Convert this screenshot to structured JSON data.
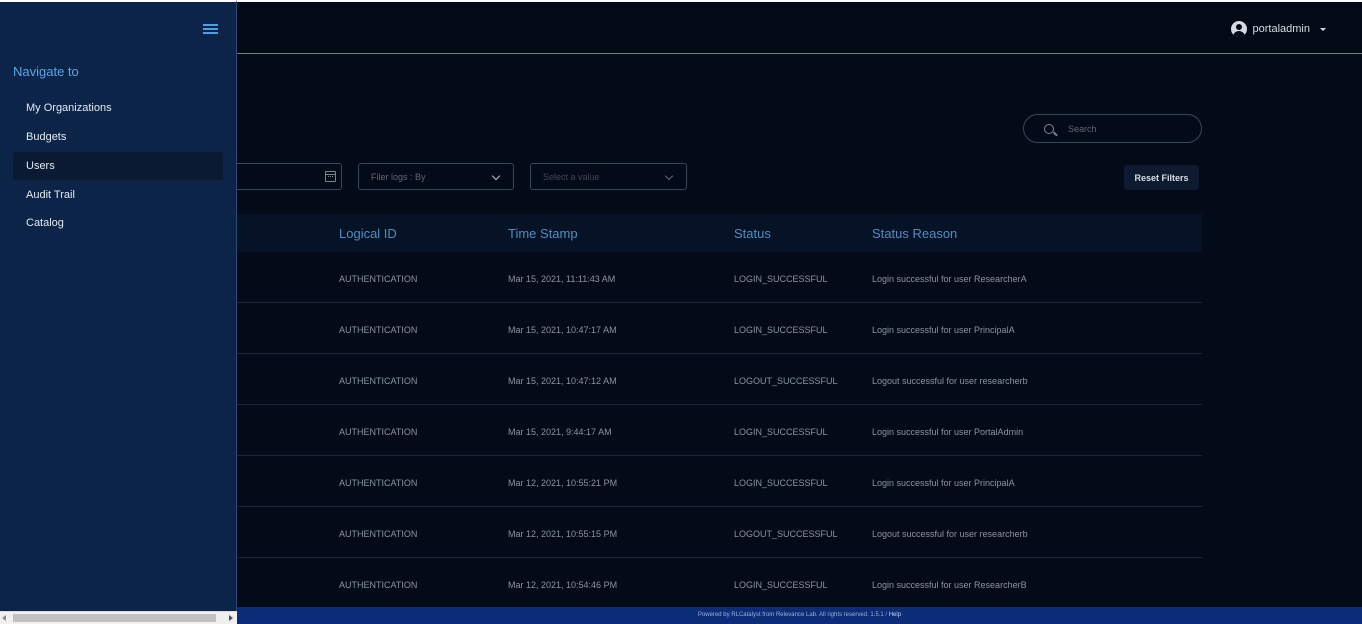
{
  "header": {
    "username": "portaladmin"
  },
  "sidebar": {
    "title": "Navigate to",
    "items": [
      {
        "label": "My Organizations",
        "active": false
      },
      {
        "label": "Budgets",
        "active": false
      },
      {
        "label": "Users",
        "active": true
      },
      {
        "label": "Audit Trail",
        "active": false
      },
      {
        "label": "Catalog",
        "active": false
      }
    ]
  },
  "search": {
    "placeholder": "Search"
  },
  "filters": {
    "date_placeholder": "e",
    "filter_by_placeholder": "Filer logs : By",
    "value_placeholder": "Select a value",
    "reset_label": "Reset Filters"
  },
  "table": {
    "columns": [
      "Logical ID",
      "Time Stamp",
      "Status",
      "Status Reason"
    ],
    "rows": [
      [
        "AUTHENTICATION",
        "Mar 15, 2021, 11:11:43 AM",
        "LOGIN_SUCCESSFUL",
        "Login successful for user ResearcherA"
      ],
      [
        "AUTHENTICATION",
        "Mar 15, 2021, 10:47:17 AM",
        "LOGIN_SUCCESSFUL",
        "Login successful for user PrincipalA"
      ],
      [
        "AUTHENTICATION",
        "Mar 15, 2021, 10:47:12 AM",
        "LOGOUT_SUCCESSFUL",
        "Logout successful for user researcherb"
      ],
      [
        "AUTHENTICATION",
        "Mar 15, 2021, 9:44:17 AM",
        "LOGIN_SUCCESSFUL",
        "Login successful for user PortalAdmin"
      ],
      [
        "AUTHENTICATION",
        "Mar 12, 2021, 10:55:21 PM",
        "LOGIN_SUCCESSFUL",
        "Login successful for user PrincipalA"
      ],
      [
        "AUTHENTICATION",
        "Mar 12, 2021, 10:55:15 PM",
        "LOGOUT_SUCCESSFUL",
        "Logout successful for user researcherb"
      ],
      [
        "AUTHENTICATION",
        "Mar 12, 2021, 10:54:46 PM",
        "LOGIN_SUCCESSFUL",
        "Login successful for user ResearcherB"
      ]
    ]
  },
  "footer": {
    "text": "Powered by RLCatalyst from Relevance Lab. All rights reserved. 1.5.1 / ",
    "help_label": "Help"
  }
}
